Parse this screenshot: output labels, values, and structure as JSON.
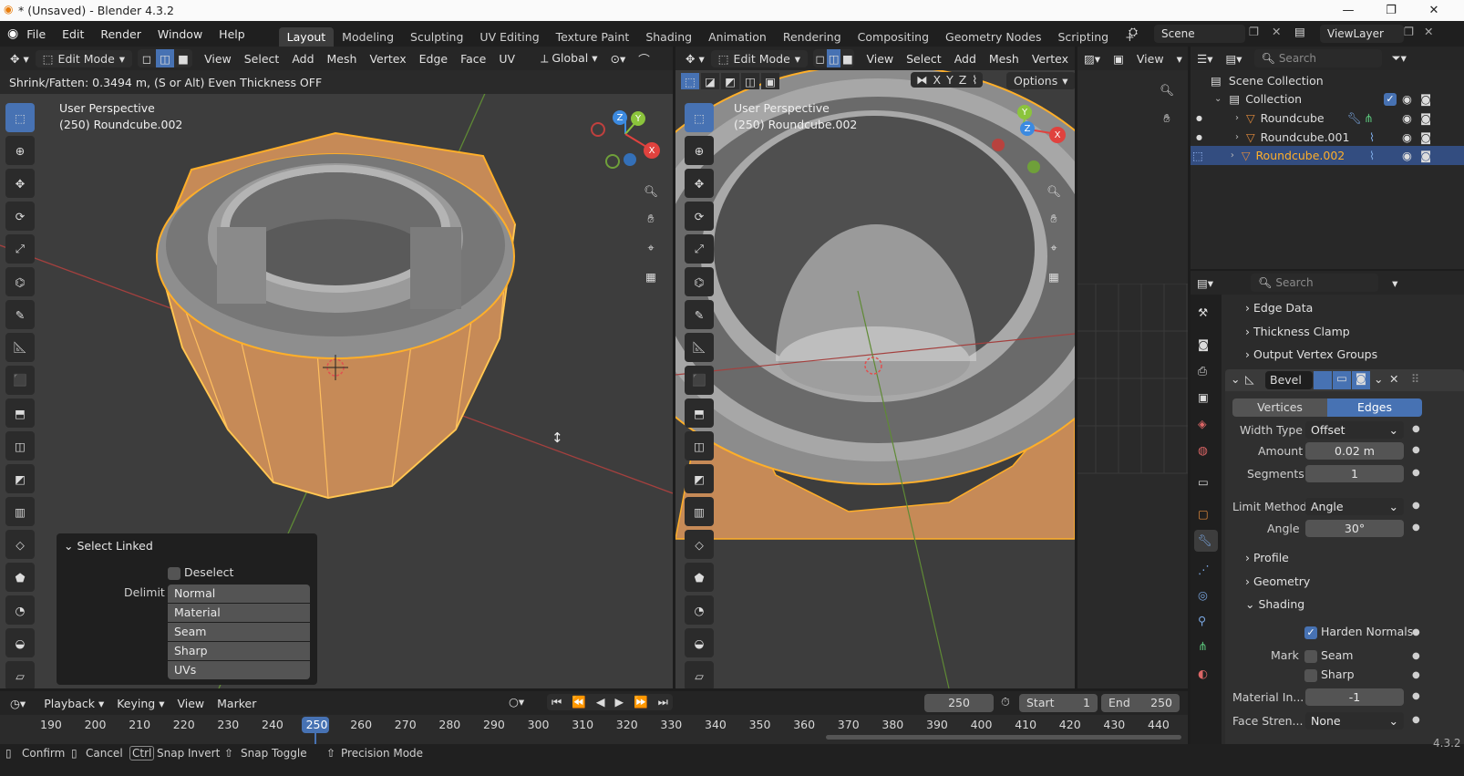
{
  "titlebar": {
    "title": "* (Unsaved) - Blender 4.3.2"
  },
  "menus": [
    "File",
    "Edit",
    "Render",
    "Window",
    "Help"
  ],
  "workspaces": [
    "Layout",
    "Modeling",
    "Sculpting",
    "UV Editing",
    "Texture Paint",
    "Shading",
    "Animation",
    "Rendering",
    "Compositing",
    "Geometry Nodes",
    "Scripting",
    "+"
  ],
  "scene": {
    "name": "Scene",
    "view_layer": "ViewLayer"
  },
  "left_viewport": {
    "mode": "Edit Mode",
    "menus": [
      "View",
      "Select",
      "Add",
      "Mesh",
      "Vertex",
      "Edge",
      "Face",
      "UV"
    ],
    "orientation": "Global",
    "status": "Shrink/Fatten: 0.3494 m, (S or Alt) Even Thickness OFF",
    "persp": "User Perspective",
    "object": "(250) Roundcube.002",
    "gizmo": {
      "x": "X",
      "y": "Y",
      "z": "Z"
    }
  },
  "right_viewport": {
    "mode": "Edit Mode",
    "menus": [
      "View",
      "Select",
      "Add",
      "Mesh",
      "Vertex"
    ],
    "options": "Options",
    "persp": "User Perspective",
    "object": "(250) Roundcube.002",
    "axes": [
      "X",
      "Y",
      "Z"
    ],
    "gizmo": {
      "x": "X",
      "y": "Y",
      "z": "Z"
    }
  },
  "small_view": {
    "label": "View"
  },
  "select_linked": {
    "title": "Select Linked",
    "deselect": "Deselect",
    "delimit_label": "Delimit",
    "delimit": [
      "Normal",
      "Material",
      "Seam",
      "Sharp",
      "UVs"
    ]
  },
  "outliner": {
    "search": "Search",
    "root": "Scene Collection",
    "collection": "Collection",
    "items": [
      "Roundcube",
      "Roundcube.001",
      "Roundcube.002"
    ]
  },
  "properties": {
    "search": "Search",
    "sections_top": [
      "Edge Data",
      "Thickness Clamp",
      "Output Vertex Groups"
    ],
    "modifier_name": "Bevel",
    "tabs": [
      "Vertices",
      "Edges"
    ],
    "width_type": {
      "label": "Width Type",
      "value": "Offset"
    },
    "amount": {
      "label": "Amount",
      "value": "0.02 m"
    },
    "segments": {
      "label": "Segments",
      "value": "1"
    },
    "limit_method": {
      "label": "Limit Method",
      "value": "Angle"
    },
    "angle": {
      "label": "Angle",
      "value": "30°"
    },
    "sections_mid": [
      "Profile",
      "Geometry",
      "Shading"
    ],
    "harden_normals": "Harden Normals",
    "mark": {
      "label": "Mark",
      "seam": "Seam",
      "sharp": "Sharp"
    },
    "material_index": {
      "label": "Material In...",
      "value": "-1"
    },
    "face_strength": {
      "label": "Face Stren...",
      "value": "None"
    }
  },
  "timeline": {
    "menus": [
      "Playback",
      "Keying",
      "View",
      "Marker"
    ],
    "current": "250",
    "start_label": "Start",
    "start": "1",
    "end_label": "End",
    "end": "250",
    "ticks": [
      "190",
      "200",
      "210",
      "220",
      "230",
      "240",
      "250",
      "260",
      "270",
      "280",
      "290",
      "300",
      "310",
      "320",
      "330",
      "340",
      "350",
      "360",
      "370",
      "380",
      "390",
      "400",
      "410",
      "420",
      "430",
      "440"
    ]
  },
  "statusbar": {
    "confirm": "Confirm",
    "cancel": "Cancel",
    "snap_invert": "Snap Invert",
    "snap_toggle": "Snap Toggle",
    "precision": "Precision Mode",
    "ctrl": "Ctrl",
    "version": "4.3.2"
  },
  "colors": {
    "accent": "#4772b3",
    "selection": "#ffaf29",
    "viewport_bg": "#3d3d3d",
    "x_axis": "#e0423e",
    "y_axis": "#8bc43c",
    "z_axis": "#3c8ae0"
  }
}
